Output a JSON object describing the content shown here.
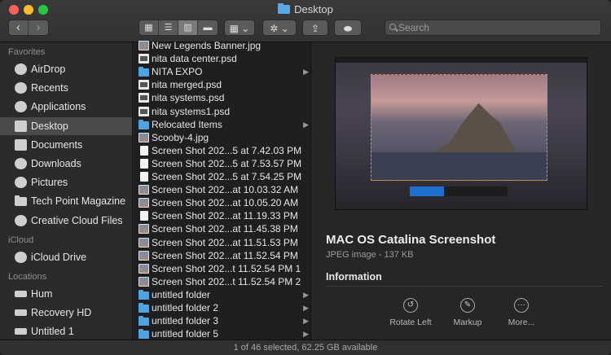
{
  "window": {
    "title": "Desktop"
  },
  "toolbar": {
    "back": "‹",
    "forward": "›",
    "search_placeholder": "Search"
  },
  "sidebar": {
    "favorites_header": "Favorites",
    "favorites": [
      {
        "label": "AirDrop",
        "icon": "airdrop-icon"
      },
      {
        "label": "Recents",
        "icon": "clock-icon"
      },
      {
        "label": "Applications",
        "icon": "applications-icon"
      },
      {
        "label": "Desktop",
        "icon": "desktop-icon",
        "selected": true
      },
      {
        "label": "Documents",
        "icon": "document-icon"
      },
      {
        "label": "Downloads",
        "icon": "download-icon"
      },
      {
        "label": "Pictures",
        "icon": "pictures-icon"
      },
      {
        "label": "Tech Point Magazine",
        "icon": "folder-icon"
      },
      {
        "label": "Creative Cloud Files",
        "icon": "creative-cloud-icon"
      }
    ],
    "icloud_header": "iCloud",
    "icloud": [
      {
        "label": "iCloud Drive",
        "icon": "cloud-icon"
      }
    ],
    "locations_header": "Locations",
    "locations": [
      {
        "label": "Hum",
        "icon": "drive-icon"
      },
      {
        "label": "Recovery HD",
        "icon": "drive-icon"
      },
      {
        "label": "Untitled 1",
        "icon": "drive-icon"
      }
    ]
  },
  "files": [
    {
      "name": "New Legends Banner.jpg",
      "type": "img"
    },
    {
      "name": "nita data center.psd",
      "type": "doc"
    },
    {
      "name": "NITA EXPO",
      "type": "dir"
    },
    {
      "name": "nita merged.psd",
      "type": "doc"
    },
    {
      "name": "nita systems.psd",
      "type": "doc"
    },
    {
      "name": "nita systems1.psd",
      "type": "doc"
    },
    {
      "name": "Relocated Items",
      "type": "dir"
    },
    {
      "name": "Scooby-4.jpg",
      "type": "img"
    },
    {
      "name": "Screen Shot 202...5 at 7.42.03 PM",
      "type": "shot"
    },
    {
      "name": "Screen Shot 202...5 at 7.53.57 PM",
      "type": "shot"
    },
    {
      "name": "Screen Shot 202...5 at 7.54.25 PM",
      "type": "shot"
    },
    {
      "name": "Screen Shot 202...at 10.03.32 AM",
      "type": "img"
    },
    {
      "name": "Screen Shot 202...at 10.05.20 AM",
      "type": "img"
    },
    {
      "name": "Screen Shot 202...at 11.19.33 PM",
      "type": "shot"
    },
    {
      "name": "Screen Shot 202...at 11.45.38 PM",
      "type": "img"
    },
    {
      "name": "Screen Shot 202...at 11.51.53 PM",
      "type": "img"
    },
    {
      "name": "Screen Shot 202...at 11.52.54 PM",
      "type": "img"
    },
    {
      "name": "Screen Shot 202...t 11.52.54 PM 1",
      "type": "img"
    },
    {
      "name": "Screen Shot 202...t 11.52.54 PM 2",
      "type": "img"
    },
    {
      "name": "untitled folder",
      "type": "dir"
    },
    {
      "name": "untitled folder 2",
      "type": "dir"
    },
    {
      "name": "untitled folder 3",
      "type": "dir"
    },
    {
      "name": "untitled folder 5",
      "type": "dir"
    }
  ],
  "preview": {
    "title": "MAC OS Catalina Screenshot",
    "subtitle": "JPEG image - 137 KB",
    "info_header": "Information",
    "actions": [
      {
        "label": "Rotate Left",
        "icon": "rotate-left-icon",
        "glyph": "↺"
      },
      {
        "label": "Markup",
        "icon": "markup-icon",
        "glyph": "✎"
      },
      {
        "label": "More...",
        "icon": "more-icon",
        "glyph": "···"
      }
    ]
  },
  "status": "1 of 46 selected, 62.25 GB available"
}
